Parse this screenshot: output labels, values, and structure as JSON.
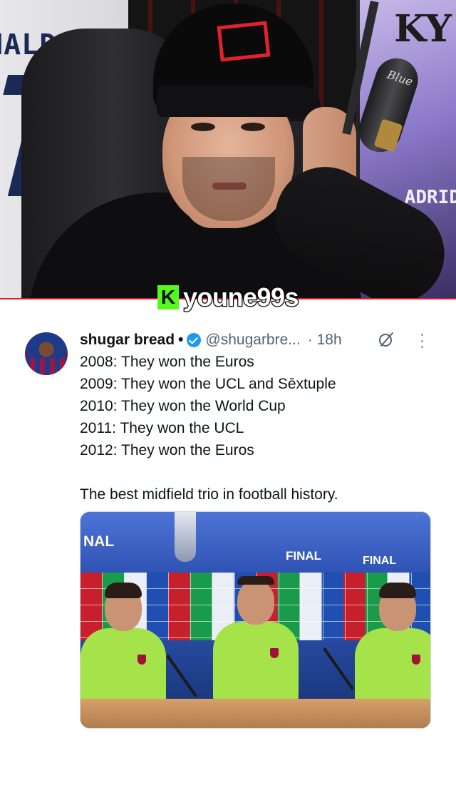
{
  "stream": {
    "platform_logo": "K",
    "username": "youne99s",
    "jersey_name": "NALDO",
    "poster_text": "KY",
    "poster_text_2": "ADRID",
    "mic_brand": "Blue"
  },
  "tweet": {
    "display_name": "shugar bread",
    "separator": "•",
    "handle": "@shugarbre...",
    "time": "· 18h",
    "verified": true,
    "verified_color": "#1d9bf0",
    "grok_icon": "grok-icon",
    "more_icon": "more-horizontal-icon",
    "lines": [
      "2008: They won the Euros",
      "2009: They won the UCL and Sēxtuple",
      "2010: They won the World Cup",
      "2011: They won the UCL",
      "2012: They won the Euros"
    ],
    "closing_line": "The best midfield trio in football history.",
    "media": {
      "banner_left": "NAL",
      "banner_mid": "FINAL",
      "banner_right": "FINAL"
    }
  },
  "colors": {
    "accent_red": "#e11d2a",
    "kick_green": "#53fc18",
    "text_primary": "#0f1419",
    "text_secondary": "#536471"
  }
}
